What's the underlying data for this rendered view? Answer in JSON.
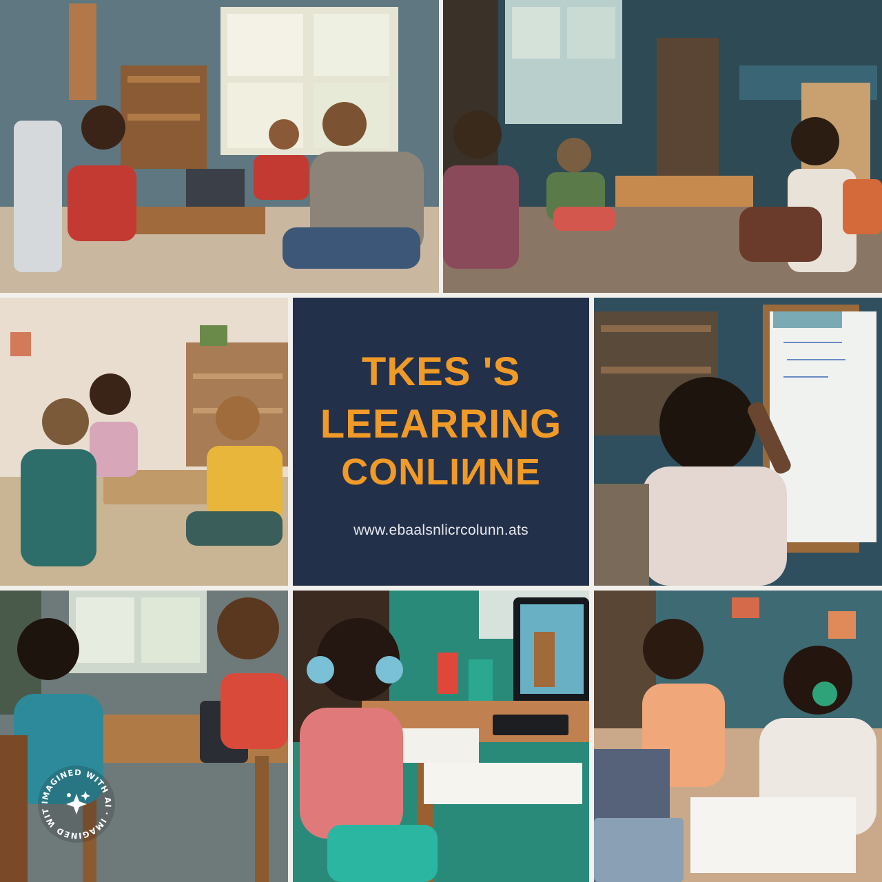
{
  "collage": {
    "title_card": {
      "line1": "TKES 'S",
      "line2": "LEEARRING",
      "line3": "CONLIИNE",
      "url": "www.ebaalsnlicrcolunn.ats",
      "colors": {
        "background": "#23304a",
        "title": "#f09a28",
        "url": "#e8e8ee"
      }
    },
    "photos": [
      {
        "name": "photo-living-room-laptop"
      },
      {
        "name": "photo-playroom-group"
      },
      {
        "name": "photo-kids-at-low-table"
      },
      {
        "name": "photo-girl-whiteboard"
      },
      {
        "name": "photo-boy-tablet-writing"
      },
      {
        "name": "photo-girl-headphones-computer"
      },
      {
        "name": "photo-girls-headphones-couch"
      }
    ],
    "badge": {
      "text": "IMAGINED WITH AI · IMAGINED WITH AI ·",
      "icon": "sparkle-icon"
    }
  }
}
